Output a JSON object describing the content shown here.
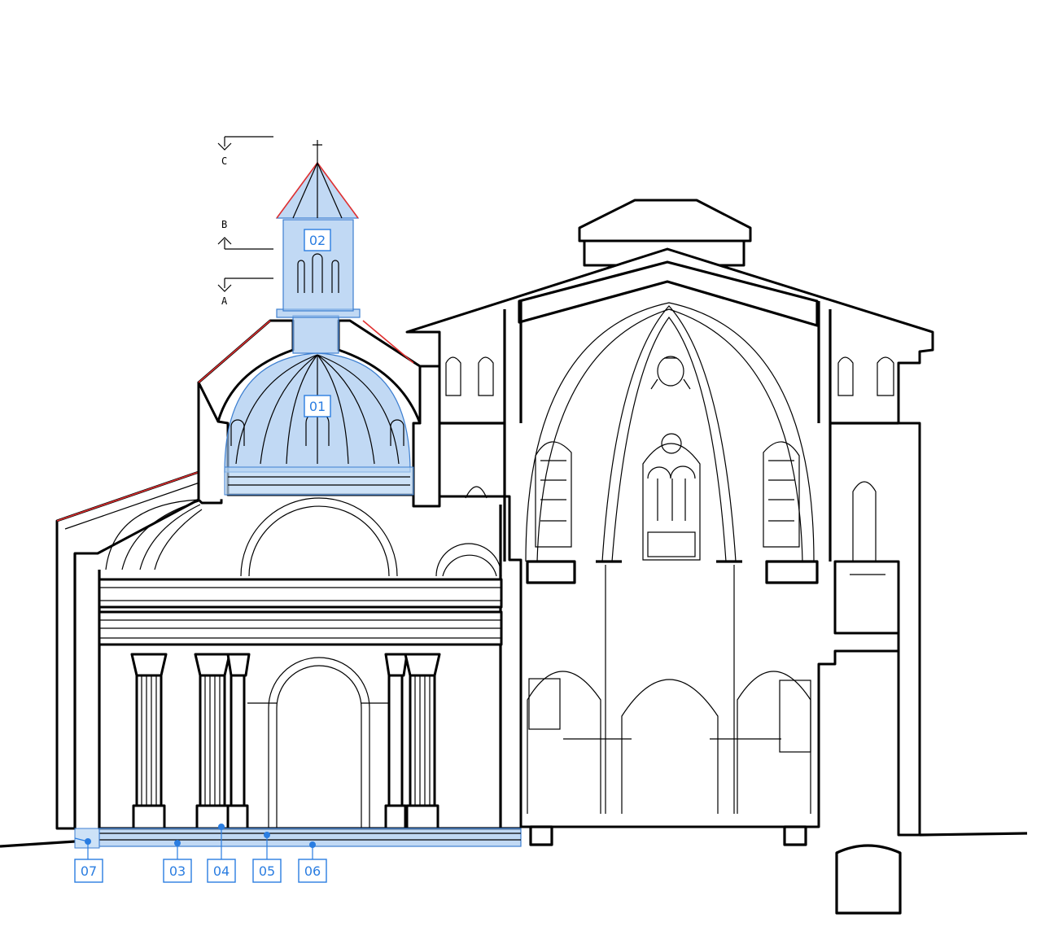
{
  "section_marks": [
    {
      "letter": "C",
      "dir": "down"
    },
    {
      "letter": "B",
      "dir": "up"
    },
    {
      "letter": "A",
      "dir": "down"
    }
  ],
  "callouts": [
    {
      "label": "01",
      "element": "dome"
    },
    {
      "label": "02",
      "element": "lantern"
    },
    {
      "label": "03",
      "element": "floor-layer"
    },
    {
      "label": "04",
      "element": "floor-layer"
    },
    {
      "label": "05",
      "element": "floor-layer"
    },
    {
      "label": "06",
      "element": "floor-layer"
    },
    {
      "label": "07",
      "element": "foundation-edge"
    }
  ],
  "colors": {
    "highlight": "#9fc5ee",
    "callout": "#2a7de1",
    "roof_edge": "#e03030",
    "line": "#000000"
  }
}
